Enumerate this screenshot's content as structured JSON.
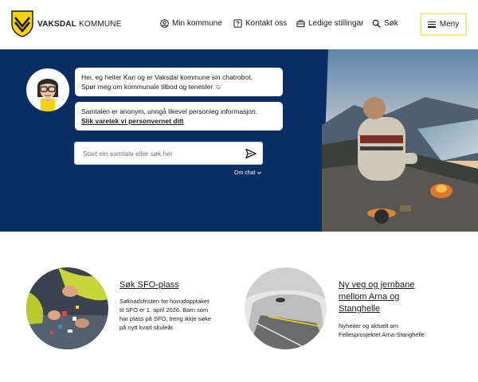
{
  "header": {
    "logo_bold": "VAKSDAL",
    "logo_rest": " KOMMUNE",
    "nav": [
      {
        "label": "Min kommune",
        "icon": "user-circle-icon"
      },
      {
        "label": "Kontakt oss",
        "icon": "question-box-icon"
      },
      {
        "label": "Ledige stillingar",
        "icon": "briefcase-icon"
      },
      {
        "label": "Søk",
        "icon": "search-icon"
      }
    ],
    "menu_label": "Meny"
  },
  "chat": {
    "greeting_line1": "Hei, eg heiter Kari og er Vaksdal kommune sin chatrobot.",
    "greeting_line2": "Spør meg om kommunale tilbod og tenester ☺",
    "privacy_text": "Samtalen er anonym, unngå likevel personleg informasjon.",
    "privacy_link": "Slik varetek vi personvernet ditt",
    "input_placeholder": "Start ein samtale eller søk her",
    "about_label": "Om chat"
  },
  "cards": [
    {
      "title": "Søk SFO-plass",
      "text_lines": [
        "Søknadsfristen for hovudopptaket",
        "til SFO er 1. april 2026. Barn som",
        "har plass på SFO, treng ikkje søke",
        "på nytt kvart skuleår."
      ]
    },
    {
      "title_lines": [
        "Ny veg og jernbane",
        "mellom Arna og",
        "Stanghelle"
      ],
      "text_lines": [
        "Nyheiter og aktuelt om",
        "Fellesprosjektet Arna-Stanghelle"
      ]
    }
  ],
  "colors": {
    "hero_bg": "#0b2d66",
    "brand_yellow": "#f5d20a",
    "menu_border": "#f3e88a"
  }
}
